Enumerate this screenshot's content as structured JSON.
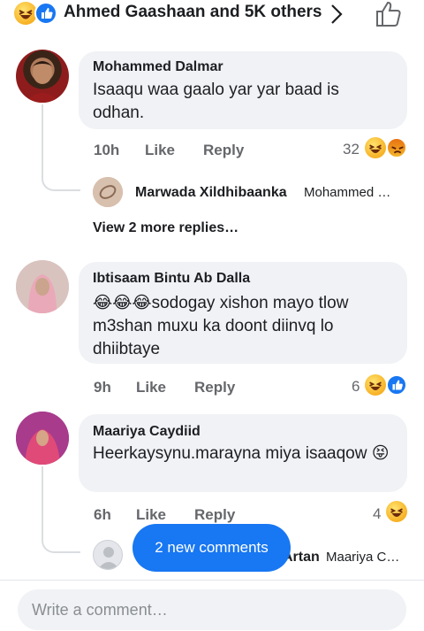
{
  "header": {
    "reaction_summary": "Ahmed Gaashaan and 5K others",
    "icons": [
      "haha-icon",
      "like-icon",
      "chevron-right-icon",
      "thumbs-up-outline-icon"
    ]
  },
  "comments": [
    {
      "author": "Mohammed Dalmar",
      "text": "Isaaqu waa gaalo yar yar baad is odhan.",
      "time": "10h",
      "like_label": "Like",
      "reply_label": "Reply",
      "reaction_count": "32",
      "reactions": [
        "haha",
        "angry"
      ],
      "reply_preview": {
        "author": "Marwada Xildhibaanka",
        "snippet": "Mohammed …"
      },
      "more_replies": "View 2 more replies…"
    },
    {
      "author": "Ibtisaam Bintu Ab Dalla",
      "text": "😂😂😂sodogay xishon mayo tlow m3shan muxu ka doont diinvq lo dhiibtaye",
      "time": "9h",
      "like_label": "Like",
      "reply_label": "Reply",
      "reaction_count": "6",
      "reactions": [
        "haha",
        "like"
      ]
    },
    {
      "author": "Maariya Caydiid",
      "text": "Heerkaysynu.marayna miya isaaqow 😝",
      "time": "6h",
      "like_label": "Like",
      "reply_label": "Reply",
      "reaction_count": "4",
      "reactions": [
        "haha"
      ],
      "reply_preview": {
        "author_tail": "Artan",
        "snippet": "Maariya C…"
      }
    }
  ],
  "new_comments_pill": "2 new comments",
  "composer": {
    "placeholder": "Write a comment…"
  },
  "colors": {
    "accent": "#1877f2",
    "bubble": "#f0f2f5",
    "meta": "#65676b"
  }
}
